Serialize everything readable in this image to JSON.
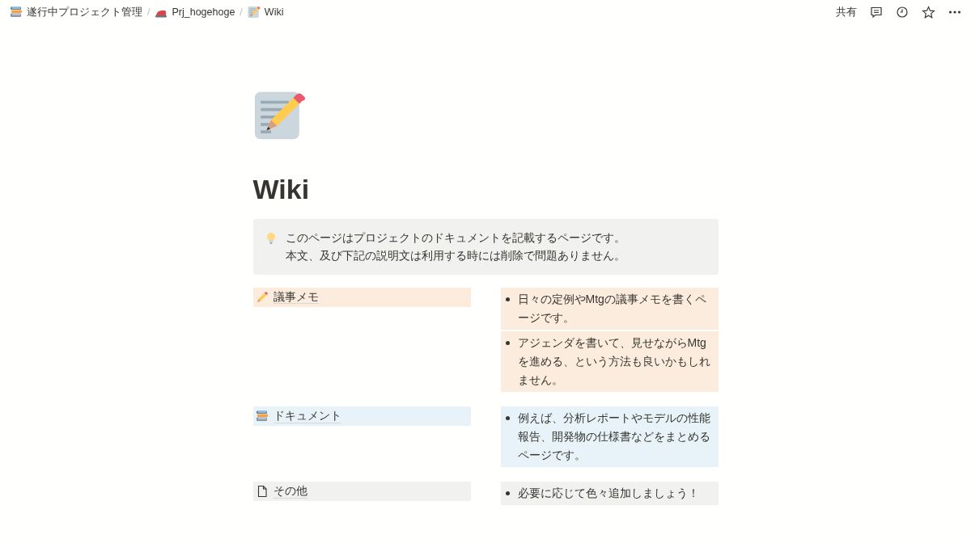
{
  "breadcrumbs": [
    {
      "kind": "books",
      "label": "遂行中プロジェクト管理"
    },
    {
      "kind": "iron",
      "label": "Prj_hogehoge"
    },
    {
      "kind": "memo",
      "label": "Wiki"
    }
  ],
  "separator": "/",
  "topbar": {
    "share": "共有"
  },
  "page": {
    "kind": "memo",
    "title": "Wiki"
  },
  "callout": {
    "kind": "bulb",
    "lines": [
      "このページはプロジェクトのドキュメントを記載するページです。",
      "本文、及び下記の説明文は利用する時には削除で問題ありません。"
    ]
  },
  "sections": [
    {
      "kind": "pencil",
      "title": "議事メモ",
      "color": "#fbecdd",
      "bullets": [
        "日々の定例やMtgの議事メモを書くページです。",
        "アジェンダを書いて、見せながらMtgを進める、という方法も良いかもしれません。"
      ]
    },
    {
      "kind": "books",
      "title": "ドキュメント",
      "color": "#e7f3f8",
      "bullets": [
        "例えば、分析レポートやモデルの性能報告、開発物の仕様書などをまとめるページです。"
      ]
    },
    {
      "kind": "page",
      "title": "その他",
      "color": "#f1f1ef",
      "bullets": [
        "必要に応じて色々追加しましょう！"
      ]
    }
  ]
}
